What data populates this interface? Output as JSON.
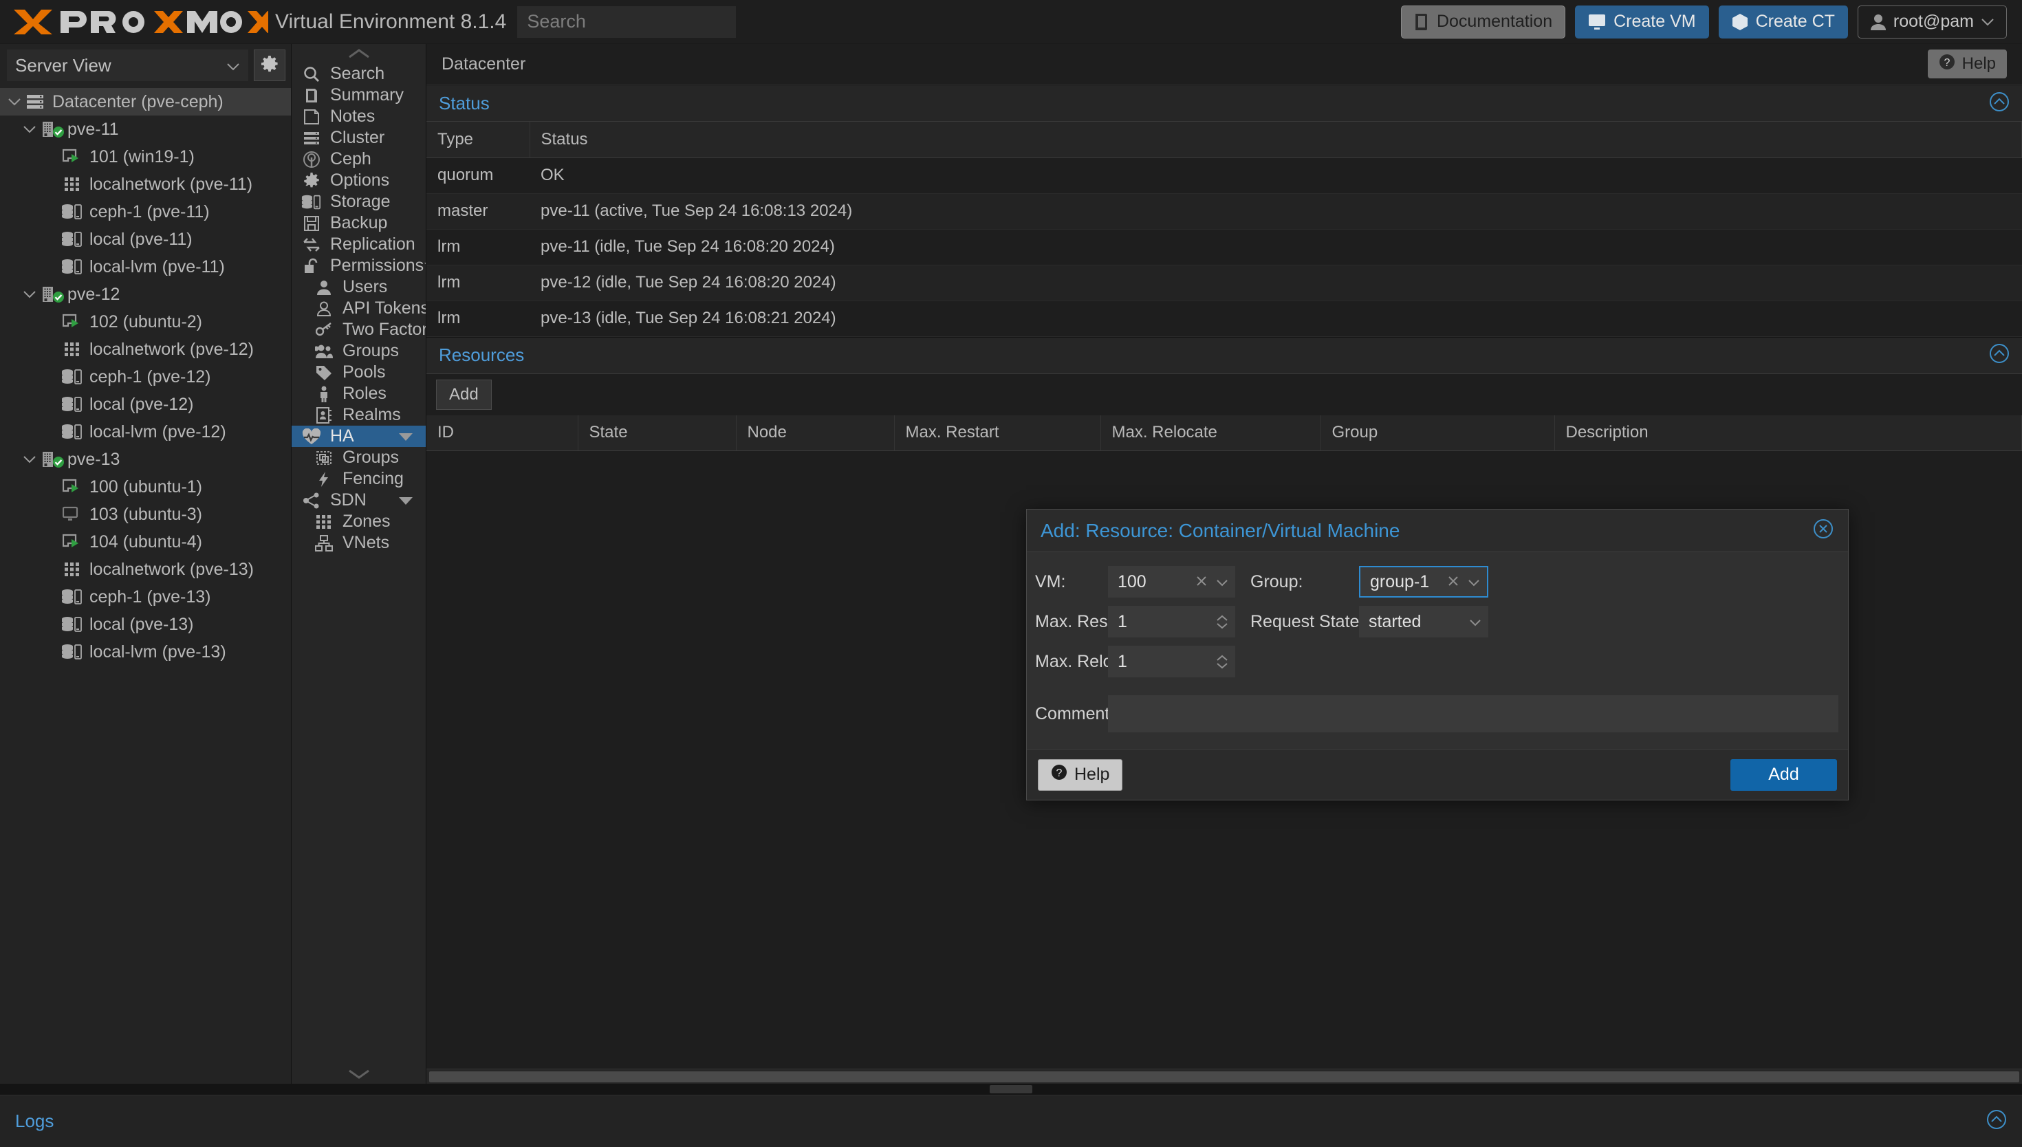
{
  "topbar": {
    "brand": "PROXMOX",
    "product": "Virtual Environment 8.1.4",
    "search_placeholder": "Search",
    "search_value": "",
    "buttons": [
      {
        "label": "Documentation",
        "icon": "book-icon",
        "style": "grey"
      },
      {
        "label": "Create VM",
        "icon": "monitor-icon",
        "style": "blue"
      },
      {
        "label": "Create CT",
        "icon": "cube-icon",
        "style": "blue"
      },
      {
        "label": "root@pam",
        "icon": "user-icon",
        "style": "outline"
      }
    ],
    "colors": {
      "brand_orange": "#e57000",
      "accent_blue": "#2a5f8f",
      "link_blue": "#4f9ddb"
    }
  },
  "sidebar": {
    "view_selector": "Server View",
    "gear_icon": "gear-icon",
    "tree": [
      {
        "label": "Datacenter (pve-ceph)",
        "depth": 0,
        "icon": "datacenter-icon",
        "expander": "expanded",
        "selected": true
      },
      {
        "label": "pve-11",
        "depth": 1,
        "icon": "node-icon",
        "expander": "expanded",
        "status": "online"
      },
      {
        "label": "101 (win19-1)",
        "depth": 2,
        "icon": "vm-running-icon"
      },
      {
        "label": "localnetwork (pve-11)",
        "depth": 2,
        "icon": "network-icon"
      },
      {
        "label": "ceph-1 (pve-11)",
        "depth": 2,
        "icon": "storage-icon"
      },
      {
        "label": "local (pve-11)",
        "depth": 2,
        "icon": "storage-icon"
      },
      {
        "label": "local-lvm (pve-11)",
        "depth": 2,
        "icon": "storage-icon"
      },
      {
        "label": "pve-12",
        "depth": 1,
        "icon": "node-icon",
        "expander": "expanded",
        "status": "online"
      },
      {
        "label": "102 (ubuntu-2)",
        "depth": 2,
        "icon": "vm-running-icon"
      },
      {
        "label": "localnetwork (pve-12)",
        "depth": 2,
        "icon": "network-icon"
      },
      {
        "label": "ceph-1 (pve-12)",
        "depth": 2,
        "icon": "storage-icon"
      },
      {
        "label": "local (pve-12)",
        "depth": 2,
        "icon": "storage-icon"
      },
      {
        "label": "local-lvm (pve-12)",
        "depth": 2,
        "icon": "storage-icon"
      },
      {
        "label": "pve-13",
        "depth": 1,
        "icon": "node-icon",
        "expander": "expanded",
        "status": "online"
      },
      {
        "label": "100 (ubuntu-1)",
        "depth": 2,
        "icon": "vm-running-icon"
      },
      {
        "label": "103 (ubuntu-3)",
        "depth": 2,
        "icon": "vm-stopped-icon"
      },
      {
        "label": "104 (ubuntu-4)",
        "depth": 2,
        "icon": "vm-running-icon"
      },
      {
        "label": "localnetwork (pve-13)",
        "depth": 2,
        "icon": "network-icon"
      },
      {
        "label": "ceph-1 (pve-13)",
        "depth": 2,
        "icon": "storage-icon"
      },
      {
        "label": "local (pve-13)",
        "depth": 2,
        "icon": "storage-icon"
      },
      {
        "label": "local-lvm (pve-13)",
        "depth": 2,
        "icon": "storage-icon"
      }
    ]
  },
  "nav": {
    "scroll_up_icon": "chevron-up-icon",
    "scroll_down_icon": "chevron-down-icon",
    "items": [
      {
        "label": "Search",
        "icon": "search-icon",
        "sub": false
      },
      {
        "label": "Summary",
        "icon": "book-icon",
        "sub": false
      },
      {
        "label": "Notes",
        "icon": "note-icon",
        "sub": false
      },
      {
        "label": "Cluster",
        "icon": "cluster-icon",
        "sub": false
      },
      {
        "label": "Ceph",
        "icon": "ceph-icon",
        "sub": false
      },
      {
        "label": "Options",
        "icon": "gear-icon",
        "sub": false
      },
      {
        "label": "Storage",
        "icon": "storage-icon",
        "sub": false
      },
      {
        "label": "Backup",
        "icon": "floppy-icon",
        "sub": false
      },
      {
        "label": "Replication",
        "icon": "replication-icon",
        "sub": false
      },
      {
        "label": "Permissions",
        "icon": "unlock-icon",
        "sub": false,
        "caret": true
      },
      {
        "label": "Users",
        "icon": "user-icon",
        "sub": true
      },
      {
        "label": "API Tokens",
        "icon": "token-user-icon",
        "sub": true
      },
      {
        "label": "Two Factor",
        "icon": "key-icon",
        "sub": true
      },
      {
        "label": "Groups",
        "icon": "users-icon",
        "sub": true
      },
      {
        "label": "Pools",
        "icon": "tag-icon",
        "sub": true
      },
      {
        "label": "Roles",
        "icon": "person-icon",
        "sub": true
      },
      {
        "label": "Realms",
        "icon": "addressbook-icon",
        "sub": true
      },
      {
        "label": "HA",
        "icon": "heartbeat-icon",
        "sub": false,
        "caret": true,
        "active": true
      },
      {
        "label": "Groups",
        "icon": "hagroup-icon",
        "sub": true
      },
      {
        "label": "Fencing",
        "icon": "bolt-icon",
        "sub": true
      },
      {
        "label": "SDN",
        "icon": "sdn-icon",
        "sub": false,
        "caret": true
      },
      {
        "label": "Zones",
        "icon": "network-icon",
        "sub": true
      },
      {
        "label": "VNets",
        "icon": "vnet-icon",
        "sub": true
      }
    ]
  },
  "breadcrumb": "Datacenter",
  "help_button": "Help",
  "status_panel": {
    "title": "Status",
    "collapse_icon": "chevron-up-circle-icon",
    "columns": [
      "Type",
      "Status"
    ],
    "rows": [
      [
        "quorum",
        "OK"
      ],
      [
        "master",
        "pve-11 (active, Tue Sep 24 16:08:13 2024)"
      ],
      [
        "lrm",
        "pve-11 (idle, Tue Sep 24 16:08:20 2024)"
      ],
      [
        "lrm",
        "pve-12 (idle, Tue Sep 24 16:08:20 2024)"
      ],
      [
        "lrm",
        "pve-13 (idle, Tue Sep 24 16:08:21 2024)"
      ]
    ]
  },
  "resources_panel": {
    "title": "Resources",
    "collapse_icon": "chevron-up-circle-icon",
    "add_button": "Add",
    "columns": [
      "ID",
      "State",
      "Node",
      "Max. Restart",
      "Max. Relocate",
      "Group",
      "Description"
    ],
    "rows": []
  },
  "logs_panel": {
    "title": "Logs",
    "collapse_icon": "chevron-up-circle-icon"
  },
  "dialog": {
    "title": "Add: Resource: Container/Virtual Machine",
    "close_icon": "close-circle-icon",
    "fields": {
      "vm_label": "VM:",
      "vm_value": "100",
      "group_label": "Group:",
      "group_value": "group-1",
      "max_restart_label": "Max. Restart:",
      "max_restart_value": "1",
      "request_state_label": "Request State:",
      "request_state_value": "started",
      "max_relocate_label": "Max. Relocate:",
      "max_relocate_value": "1",
      "comment_label": "Comment:",
      "comment_value": ""
    },
    "help_button": "Help",
    "submit_button": "Add",
    "clear_icon": "clear-x-icon",
    "dropdown_icon": "chevron-down-icon",
    "spinner_icon": "spinner-updown-icon"
  }
}
